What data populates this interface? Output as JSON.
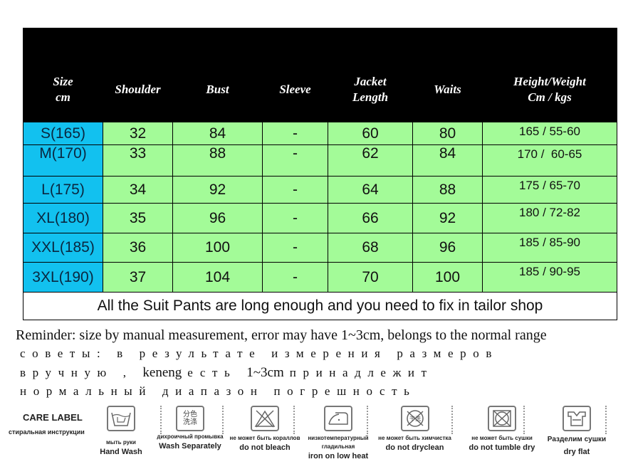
{
  "table": {
    "headers": [
      "Size\ncm",
      "Shoulder",
      "Bust",
      "Sleeve",
      "Jacket\nLength",
      "Waits",
      "Height/Weight\nCm / kgs"
    ],
    "rows": [
      {
        "size": "S(165)",
        "shoulder": "32",
        "bust": "84",
        "sleeve": "-",
        "jacket_length": "60",
        "waist": "80",
        "height_weight": "165 / 55-60"
      },
      {
        "size": "M(170)",
        "shoulder": "33",
        "bust": "88",
        "sleeve": "-",
        "jacket_length": "62",
        "waist": "84",
        "height_weight": "170 /  60-65"
      },
      {
        "size": "L(175)",
        "shoulder": "34",
        "bust": "92",
        "sleeve": "-",
        "jacket_length": "64",
        "waist": "88",
        "height_weight": "175 / 65-70"
      },
      {
        "size": "XL(180)",
        "shoulder": "35",
        "bust": "96",
        "sleeve": "-",
        "jacket_length": "66",
        "waist": "92",
        "height_weight": "180 / 72-82"
      },
      {
        "size": "XXL(185)",
        "shoulder": "36",
        "bust": "100",
        "sleeve": "-",
        "jacket_length": "68",
        "waist": "96",
        "height_weight": "185 / 85-90"
      },
      {
        "size": "3XL(190)",
        "shoulder": "37",
        "bust": "104",
        "sleeve": "-",
        "jacket_length": "70",
        "waist": "100",
        "height_weight": "185 / 90-95"
      }
    ],
    "note": "All the Suit Pants are long enough and you need to fix in tailor shop",
    "colors": {
      "header_bg": "#000000",
      "size_col_bg": "#12c1ef",
      "data_bg": "#a3fb98"
    }
  },
  "reminder": {
    "english": "Reminder: size by manual measurement, error may have 1~3cm, belongs to the normal range",
    "russian_line1": "советы: в результате измерения размеров",
    "russian_line2_a": "вручную ,",
    "russian_line2_latin1": "keneng",
    "russian_line2_b": "есть",
    "russian_line2_latin2": "1~3cm",
    "russian_line2_c": "принадлежит",
    "russian_line3": "нормальный диапазон погрешность"
  },
  "care": {
    "title": "CARE LABEL",
    "subtitle": "стиральная инструкции",
    "items": [
      {
        "icon": "hand-wash-icon",
        "ru": "мыть руки",
        "en": "Hand Wash"
      },
      {
        "icon": "wash-separately-icon",
        "icon_text": "分色\n洗涤",
        "ru": "дихроичный промывка",
        "en": "Wash Separately"
      },
      {
        "icon": "do-not-bleach-icon",
        "ru": "не может быть кораллов",
        "en": "do not bleach"
      },
      {
        "icon": "iron-low-heat-icon",
        "ru": "низкотемпературный гладильная",
        "en": "iron on low heat"
      },
      {
        "icon": "do-not-dryclean-icon",
        "icon_text": "干洗",
        "ru": "не может быть химчистка",
        "en": "do not dryclean"
      },
      {
        "icon": "do-not-tumble-dry-icon",
        "ru": "не может быть сушки",
        "en": "do not tumble dry"
      },
      {
        "icon": "dry-flat-icon",
        "ru": "Разделим сушки",
        "en": "dry flat"
      }
    ]
  }
}
